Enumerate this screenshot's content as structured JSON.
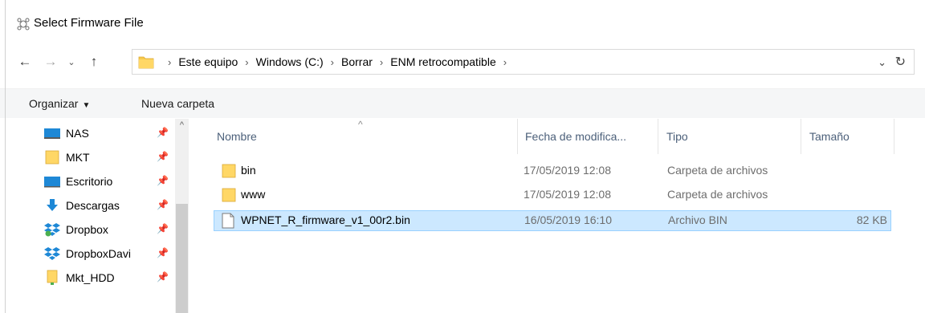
{
  "window": {
    "title": "Select Firmware File",
    "icon": "firmware-app-icon"
  },
  "address": {
    "breadcrumbs": [
      "Este equipo",
      "Windows (C:)",
      "Borrar",
      "ENM retrocompatible"
    ],
    "trailing_separator": "›"
  },
  "toolbar": {
    "organize_label": "Organizar",
    "organize_caret": "▼",
    "new_folder_label": "Nueva carpeta"
  },
  "nav_pane": {
    "items": [
      {
        "label": "NAS",
        "icon": "network-drive-icon",
        "pinned": true
      },
      {
        "label": "MKT",
        "icon": "folder-icon",
        "pinned": true
      },
      {
        "label": "Escritorio",
        "icon": "desktop-icon",
        "pinned": true
      },
      {
        "label": "Descargas",
        "icon": "download-icon",
        "pinned": true
      },
      {
        "label": "Dropbox",
        "icon": "dropbox-icon",
        "pinned": true
      },
      {
        "label": "DropboxDavi",
        "icon": "dropbox-icon",
        "pinned": true
      },
      {
        "label": "Mkt_HDD",
        "icon": "folder-icon",
        "pinned": true
      }
    ]
  },
  "file_list": {
    "columns": {
      "name": "Nombre",
      "date": "Fecha de modifica...",
      "type": "Tipo",
      "size": "Tamaño"
    },
    "rows": [
      {
        "name": "bin",
        "date": "17/05/2019 12:08",
        "type": "Carpeta de archivos",
        "size": "",
        "kind": "folder"
      },
      {
        "name": "www",
        "date": "17/05/2019 12:08",
        "type": "Carpeta de archivos",
        "size": "",
        "kind": "folder"
      },
      {
        "name": "WPNET_R_firmware_v1_00r2.bin",
        "date": "16/05/2019 16:10",
        "type": "Archivo BIN",
        "size": "82 KB",
        "kind": "file",
        "selected": true
      }
    ]
  },
  "colors": {
    "selection_bg": "#cce8ff",
    "selection_border": "#99d1ff",
    "folder_yellow": "#f7c94b",
    "header_text": "#4c607a"
  }
}
